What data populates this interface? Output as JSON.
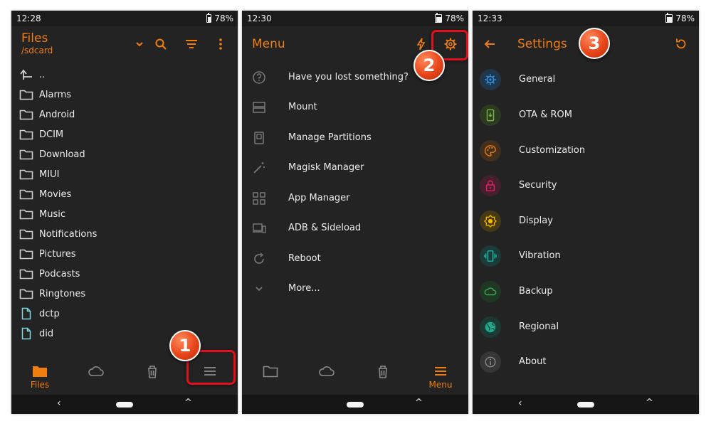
{
  "colors": {
    "accent": "#f07d10",
    "background": "#232323",
    "highlight": "#e3101b",
    "callout": "#e8451a"
  },
  "panel1": {
    "status": {
      "time": "12:28",
      "battery": "78%"
    },
    "header": {
      "title": "Files",
      "path": "/sdcard"
    },
    "toolbar_icons": [
      "chevron-down-icon",
      "search-icon",
      "sort-icon",
      "more-vert-icon"
    ],
    "files": [
      {
        "name": "..",
        "icon": "up-arrow-icon"
      },
      {
        "name": "Alarms",
        "icon": "folder-icon"
      },
      {
        "name": "Android",
        "icon": "folder-icon"
      },
      {
        "name": "DCIM",
        "icon": "folder-icon"
      },
      {
        "name": "Download",
        "icon": "folder-icon"
      },
      {
        "name": "MIUI",
        "icon": "folder-icon"
      },
      {
        "name": "Movies",
        "icon": "folder-icon"
      },
      {
        "name": "Music",
        "icon": "folder-icon"
      },
      {
        "name": "Notifications",
        "icon": "folder-icon"
      },
      {
        "name": "Pictures",
        "icon": "folder-icon"
      },
      {
        "name": "Podcasts",
        "icon": "folder-icon"
      },
      {
        "name": "Ringtones",
        "icon": "folder-icon"
      },
      {
        "name": "dctp",
        "icon": "file-icon"
      },
      {
        "name": "did",
        "icon": "file-icon"
      }
    ],
    "bottom_nav": {
      "files_label": "Files"
    },
    "callout": "1"
  },
  "panel2": {
    "status": {
      "time": "12:30",
      "battery": "78%"
    },
    "header": {
      "title": "Menu"
    },
    "items": [
      {
        "label": "Have you lost something?",
        "icon": "question-icon"
      },
      {
        "label": "Mount",
        "icon": "storage-icon"
      },
      {
        "label": "Manage Partitions",
        "icon": "partition-icon"
      },
      {
        "label": "Magisk Manager",
        "icon": "magic-wand-icon"
      },
      {
        "label": "App Manager",
        "icon": "apps-icon"
      },
      {
        "label": "ADB & Sideload",
        "icon": "devices-icon"
      },
      {
        "label": "Reboot",
        "icon": "reboot-icon"
      },
      {
        "label": "More...",
        "icon": "chevron-down-icon"
      }
    ],
    "bottom_nav": {
      "menu_label": "Menu"
    },
    "callout": "2"
  },
  "panel3": {
    "status": {
      "time": "12:33",
      "battery": "78%"
    },
    "header": {
      "title": "Settings"
    },
    "items": [
      {
        "label": "General",
        "icon": "gear-icon",
        "color": "#2f8fe0"
      },
      {
        "label": "OTA & ROM",
        "icon": "system-update-icon",
        "color": "#7cb342"
      },
      {
        "label": "Customization",
        "icon": "palette-icon",
        "color": "#f07d10"
      },
      {
        "label": "Security",
        "icon": "lock-icon",
        "color": "#e91e63"
      },
      {
        "label": "Display",
        "icon": "brightness-icon",
        "color": "#f5b800"
      },
      {
        "label": "Vibration",
        "icon": "vibration-icon",
        "color": "#1fb5a0"
      },
      {
        "label": "Backup",
        "icon": "cloud-icon",
        "color": "#3fa34d"
      },
      {
        "label": "Regional",
        "icon": "globe-icon",
        "color": "#1faa8c"
      },
      {
        "label": "About",
        "icon": "info-icon",
        "color": "#8a8a8a"
      }
    ],
    "callout": "3"
  }
}
